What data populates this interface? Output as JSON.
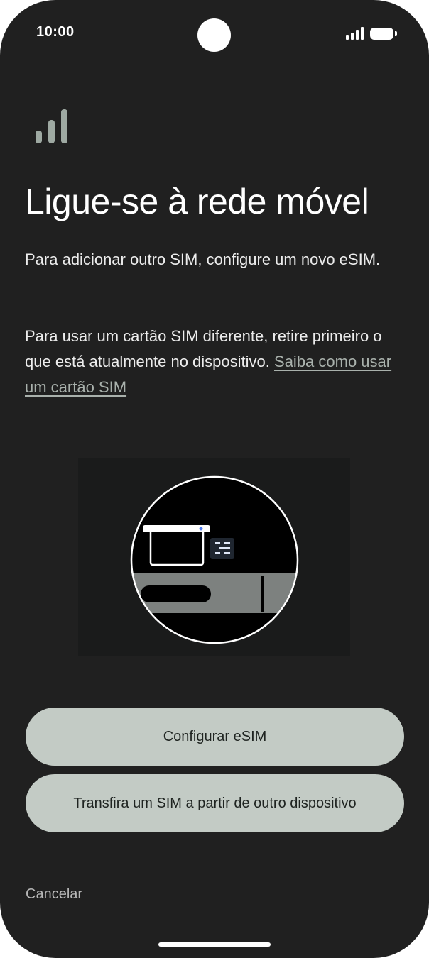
{
  "status_bar": {
    "time": "10:00",
    "icons": [
      "cellular-signal-icon",
      "battery-icon"
    ]
  },
  "header": {
    "icon": "signal-bars-icon",
    "title": "Ligue-se à rede móvel"
  },
  "body": {
    "paragraph1": "Para adicionar outro SIM, configure um novo eSIM.",
    "paragraph2": "Para usar um cartão SIM diferente, retire primeiro o que está atualmente no dispositivo.",
    "link_text": "Saiba como usar um cartão SIM"
  },
  "illustration": {
    "icon": "sim-tray-illustration"
  },
  "actions": {
    "primary_label": "Configurar eSIM",
    "secondary_label": "Transfira um SIM a partir de outro dispositivo",
    "cancel_label": "Cancelar"
  },
  "colors": {
    "background": "#202020",
    "button": "#c3cbc5",
    "accent_icon": "#9ea9a2",
    "link": "#a9b1ac"
  }
}
